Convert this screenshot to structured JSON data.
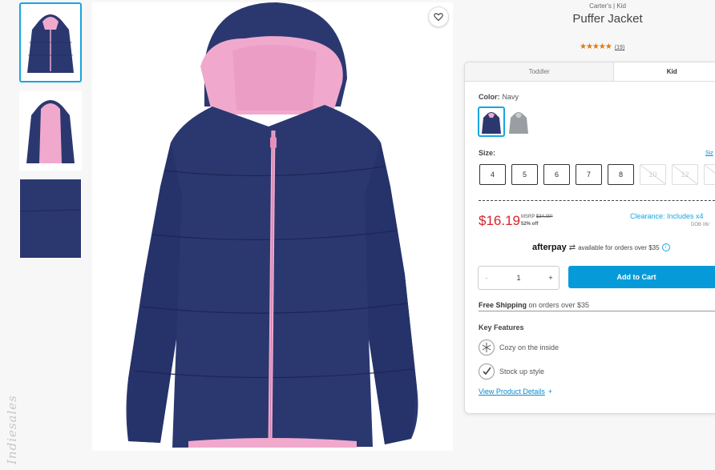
{
  "product": {
    "brand": "Carter's | Kid",
    "title": "Puffer Jacket",
    "rating_stars": "★★★★★",
    "review_count": "(19)"
  },
  "tabs": [
    "Toddler",
    "Kid"
  ],
  "color": {
    "label": "Color:",
    "value": "Navy"
  },
  "size": {
    "label": "Size:",
    "chart_link": "Siz",
    "options": [
      "4",
      "5",
      "6",
      "7",
      "8",
      "10",
      "12",
      "1"
    ]
  },
  "price": {
    "sale": "$16.19",
    "msrp_label": "MSRP",
    "msrp_value": "$34.00*",
    "discount": "52% off",
    "clearance": "Clearance: Includes x4",
    "dob": "DOB 06/"
  },
  "afterpay": {
    "brand": "afterpay",
    "text": "available for orders over $35",
    "info": "i"
  },
  "quantity": {
    "minus": "-",
    "value": "1",
    "plus": "+"
  },
  "cart_button": "Add to Cart",
  "shipping": {
    "bold": "Free Shipping",
    "text": " on orders over $35"
  },
  "features": {
    "heading": "Key Features",
    "items": [
      "Cozy on the inside",
      "Stock up style"
    ]
  },
  "details_link": "View Product Details",
  "details_plus": "+",
  "colors": {
    "navy": "#2b3870",
    "pink": "#f0a9cd",
    "accent": "#18a6e0",
    "price_red": "#d6232d",
    "cart_blue": "#069bd8"
  }
}
